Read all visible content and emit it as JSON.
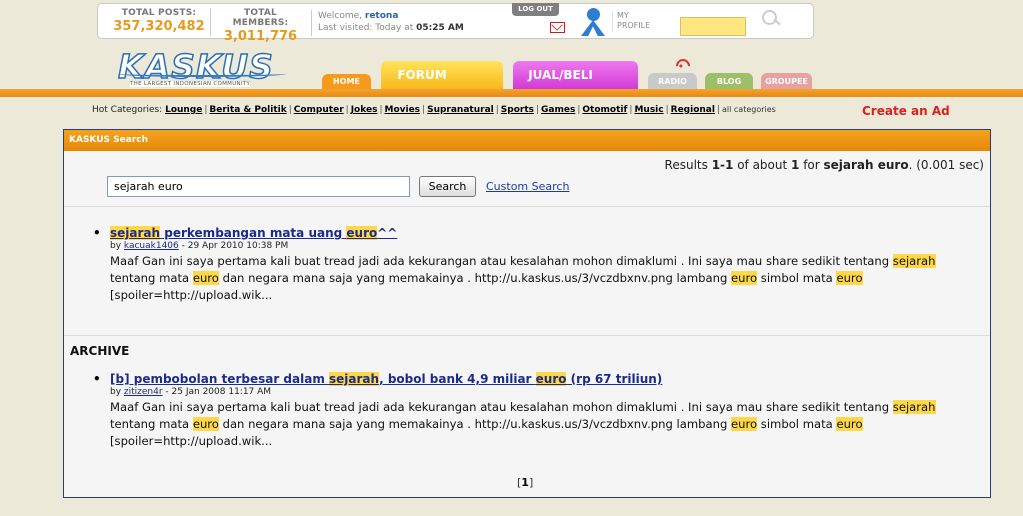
{
  "stats": {
    "total_posts_label": "TOTAL POSTS:",
    "total_posts_value": "357,320,482",
    "total_members_label": "TOTAL MEMBERS:",
    "total_members_value": "3,011,776"
  },
  "user": {
    "welcome_prefix": "Welcome, ",
    "username": "retona",
    "last_visited_prefix": "Last visited: Today at ",
    "last_visited_time": "05:25 AM",
    "logout_label": "LOG OUT",
    "my_label": "MY",
    "profile_label": "PROFILE"
  },
  "logo": {
    "text": "KASKUS",
    "tagline": "THE LARGEST INDONESIAN COMMUNITY"
  },
  "nav": {
    "home": "HOME",
    "forum": "FORUM",
    "jual_beli": "JUAL/BELI",
    "radio": "RADIO",
    "blog": "BLOG",
    "groupee": "GROUPEE"
  },
  "hot_categories": {
    "label": "Hot Categories: ",
    "items": [
      "Lounge",
      "Berita & Politik",
      "Computer",
      "Jokes",
      "Movies",
      "Supranatural",
      "Sports",
      "Games",
      "Otomotif",
      "Music",
      "Regional"
    ],
    "all_label": "all categories"
  },
  "create_ad": "Create an Ad",
  "search_panel": {
    "header": "KASKUS Search",
    "results_prefix": "Results ",
    "results_range": "1-1",
    "results_mid": " of about ",
    "results_count": "1",
    "results_for": " for ",
    "results_query": "sejarah euro",
    "results_time": ". (0.001 sec)",
    "query_value": "sejarah euro",
    "search_button": "Search",
    "custom_search": "Custom Search",
    "archive_label": "ARCHIVE",
    "pagination": "1"
  },
  "results": [
    {
      "title_parts": [
        "sejarah",
        " perkembangan mata uang ",
        "euro",
        "^^"
      ],
      "by": "by ",
      "author": "kacuak1406",
      "date": " - 29 Apr 2010 10:38 PM",
      "snippet_parts": [
        "Maaf Gan ini saya pertama kali buat tread jadi ada kekurangan atau kesalahan mohon dimaklumi . Ini saya mau share sedikit tentang ",
        "sejarah",
        " tentang mata ",
        "euro",
        " dan negara mana saja yang memakainya . http://u.kaskus.us/3/vczdbxnv.png lambang ",
        "euro",
        " simbol mata ",
        "euro",
        " [spoiler=http://upload.wik..."
      ]
    },
    {
      "title_parts": [
        "[b] pembobolan terbesar dalam ",
        "sejarah",
        ", bobol bank 4,9 miliar ",
        "euro",
        " (rp 67 triliun)"
      ],
      "by": "by ",
      "author": "zitizen4r",
      "date": " - 25 Jan 2008 11:17 AM",
      "snippet_parts": [
        "Maaf Gan ini saya pertama kali buat tread jadi ada kekurangan atau kesalahan mohon dimaklumi . Ini saya mau share sedikit tentang ",
        "sejarah",
        " tentang mata ",
        "euro",
        " dan negara mana saja yang memakainya . http://u.kaskus.us/3/vczdbxnv.png lambang ",
        "euro",
        " simbol mata ",
        "euro",
        " [spoiler=http://upload.wik..."
      ]
    }
  ],
  "colors": {
    "accent_orange": "#e7880b",
    "highlight": "#ffd84a",
    "link_blue": "#1a2b8c",
    "create_ad_red": "#dd2020"
  }
}
